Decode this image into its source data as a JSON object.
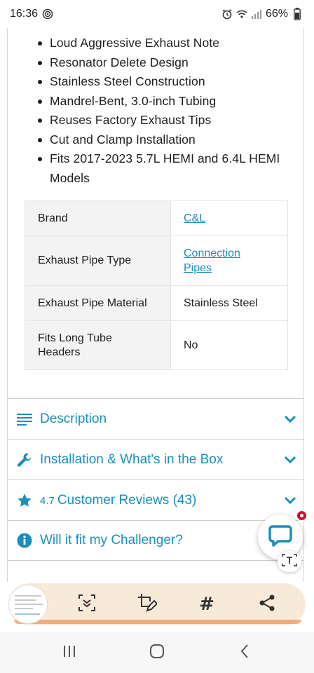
{
  "status_bar": {
    "time": "16:36",
    "battery": "66%"
  },
  "features": [
    "Loud Aggressive Exhaust Note",
    "Resonator Delete Design",
    "Stainless Steel Construction",
    "Mandrel-Bent, 3.0-inch Tubing",
    "Reuses Factory Exhaust Tips",
    "Cut and Clamp Installation",
    "Fits 2017-2023 5.7L HEMI and 6.4L HEMI Models"
  ],
  "specs": [
    {
      "label": "Brand",
      "value": "C&L",
      "is_link": true
    },
    {
      "label": "Exhaust Pipe Type",
      "value": "Connection Pipes",
      "is_link": true
    },
    {
      "label": "Exhaust Pipe Material",
      "value": "Stainless Steel",
      "is_link": false
    },
    {
      "label": "Fits Long Tube Headers",
      "value": "No",
      "is_link": false
    }
  ],
  "accordion": {
    "description": "Description",
    "installation": "Installation & What's in the Box",
    "rating": "4.7",
    "reviews": "Customer Reviews (43)",
    "fit": "Will it fit my Challenger?"
  },
  "colors": {
    "accent": "#1a8fb8",
    "toolbar_bg": "#f8ead9",
    "notification": "#d0102c"
  },
  "icons": {
    "description": "lines-icon",
    "installation": "wrench-icon",
    "reviews": "star-icon",
    "fit": "info-icon",
    "chevron": "chevron-down-icon"
  }
}
